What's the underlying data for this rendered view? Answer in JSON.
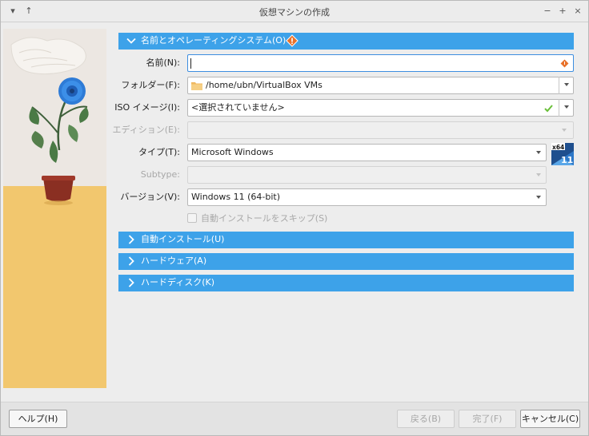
{
  "window": {
    "title": "仮想マシンの作成",
    "controls": {
      "menu": "▾",
      "pin": "↑",
      "minimize": "−",
      "maximize": "+",
      "close": "×"
    }
  },
  "sections": {
    "name_os": "名前とオペレーティングシステム(O)",
    "unattended": "自動インストール(U)",
    "hardware": "ハードウェア(A)",
    "hard_disk": "ハードディスク(K)"
  },
  "form": {
    "name": {
      "label": "名前(N):",
      "value": ""
    },
    "folder": {
      "label": "フォルダー(F):",
      "value": "/home/ubn/VirtualBox VMs"
    },
    "iso": {
      "label": "ISO イメージ(I):",
      "value": "<選択されていません>"
    },
    "edition": {
      "label": "エディション(E):",
      "value": ""
    },
    "type": {
      "label": "タイプ(T):",
      "value": "Microsoft Windows"
    },
    "subtype": {
      "label": "Subtype:",
      "value": ""
    },
    "version": {
      "label": "バージョン(V):",
      "value": "Windows 11 (64-bit)"
    },
    "skip_unattended": {
      "label": "自動インストールをスキップ(S)",
      "checked": false
    }
  },
  "os_badge": {
    "arch": "x64",
    "version": "11"
  },
  "footer": {
    "help": "ヘルプ(H)",
    "back": "戻る(B)",
    "finish": "完了(F)",
    "cancel": "キャンセル(C)"
  },
  "colors": {
    "section_bg": "#3da2e9",
    "focus_border": "#3d8ee0",
    "warning": "#e8712a",
    "ok": "#6abf3a"
  },
  "icons": {
    "section_expanded": "chevron-down-icon",
    "section_collapsed": "chevron-right-icon",
    "warning": "warning-icon",
    "folder": "folder-icon",
    "iso_ok": "check-icon",
    "os": "windows-11-x64-icon"
  }
}
